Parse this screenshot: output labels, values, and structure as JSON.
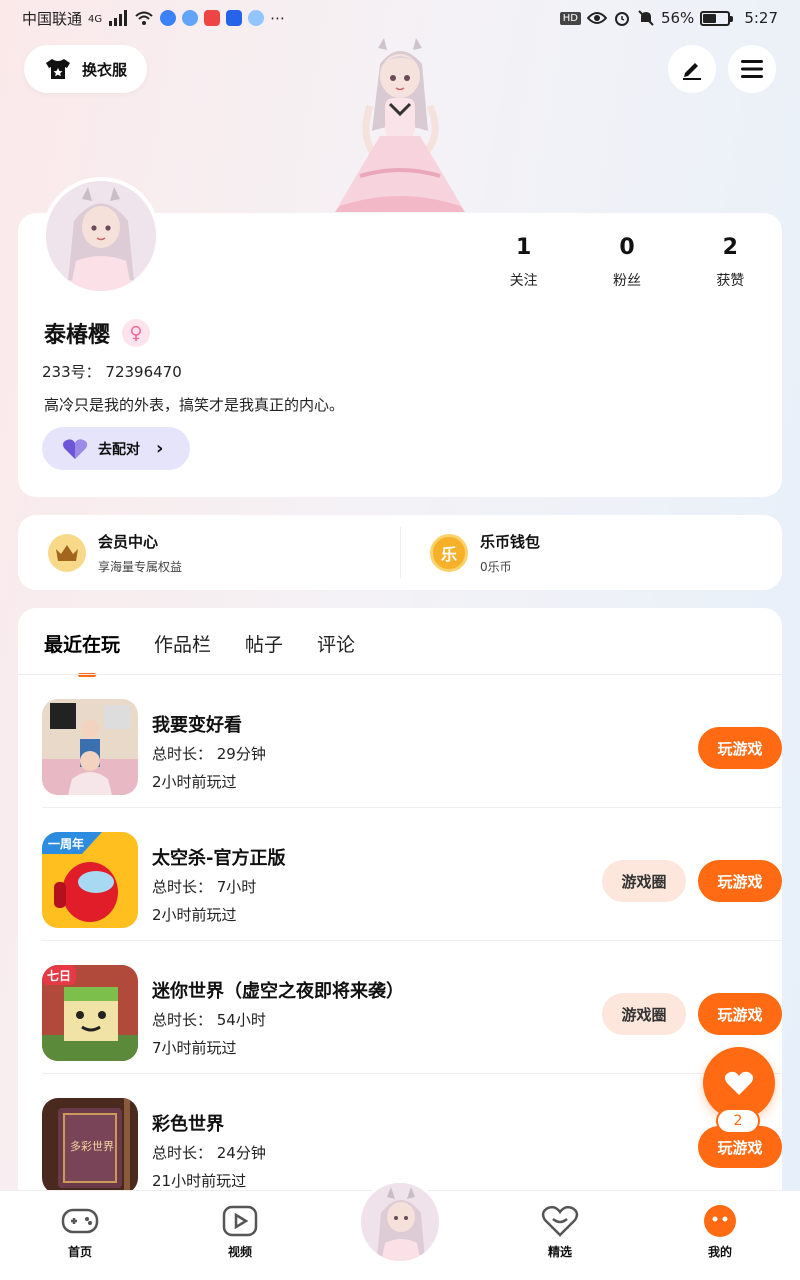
{
  "status_bar": {
    "carrier": "中国联通",
    "network": "4G",
    "battery_text": "56%",
    "battery_level": 0.56,
    "time": "5:27",
    "hd": "HD"
  },
  "header": {
    "outfit_label": "换衣服"
  },
  "profile": {
    "stats": [
      {
        "value": "1",
        "label": "关注"
      },
      {
        "value": "0",
        "label": "粉丝"
      },
      {
        "value": "2",
        "label": "获赞"
      }
    ],
    "nickname": "泰椿樱",
    "uid": "233号： 72396470",
    "bio": "高冷只是我的外表，搞笑才是我真正的内心。",
    "match_label": "去配对"
  },
  "membership": {
    "vip_title": "会员中心",
    "vip_sub": "享海量专属权益",
    "wallet_title": "乐币钱包",
    "wallet_sub": "0乐币",
    "wallet_glyph": "乐"
  },
  "tabs": [
    {
      "label": "最近在玩",
      "active": true
    },
    {
      "label": "作品栏",
      "active": false
    },
    {
      "label": "帖子",
      "active": false
    },
    {
      "label": "评论",
      "active": false
    }
  ],
  "games": [
    {
      "name": "我要变好看",
      "duration": "总时长： 29分钟",
      "last_played": "2小时前玩过",
      "circle": "",
      "play": "玩游戏"
    },
    {
      "name": "太空杀-官方正版",
      "duration": "总时长： 7小时",
      "last_played": "2小时前玩过",
      "circle": "游戏圈",
      "play": "玩游戏"
    },
    {
      "name": "迷你世界（虚空之夜即将来袭）",
      "duration": "总时长： 54小时",
      "last_played": "7小时前玩过",
      "circle": "游戏圈",
      "play": "玩游戏"
    },
    {
      "name": "彩色世界",
      "duration": "总时长： 24分钟",
      "last_played": "21小时前玩过",
      "circle": "",
      "play": "玩游戏"
    }
  ],
  "game_icon_texts": {
    "anniversary": "一周年",
    "mini": "七日",
    "color_world": "多彩世界"
  },
  "fab": {
    "badge": "2"
  },
  "bottom_nav": [
    {
      "label": "首页"
    },
    {
      "label": "视频"
    },
    {
      "label": "精选"
    },
    {
      "label": "我的"
    }
  ],
  "colors": {
    "accent": "#ff6a12",
    "match_bg": "#e5e4fb",
    "circle_bg": "#fde7dc"
  }
}
